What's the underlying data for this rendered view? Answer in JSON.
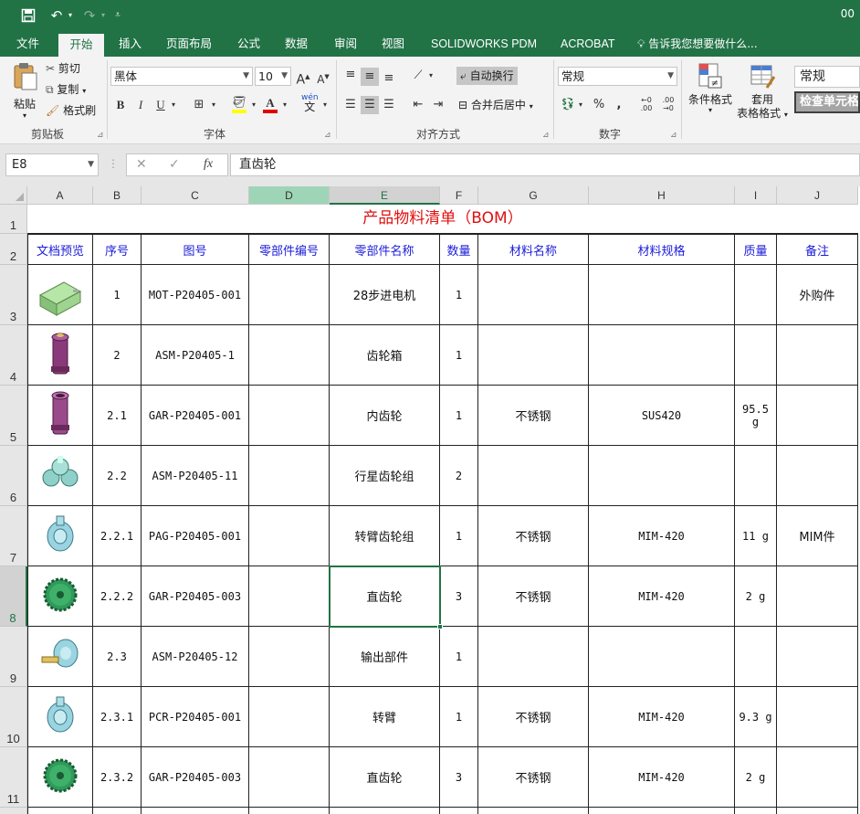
{
  "titlebar": {
    "right_text": "00"
  },
  "tabs": [
    "文件",
    "开始",
    "插入",
    "页面布局",
    "公式",
    "数据",
    "审阅",
    "视图",
    "SOLIDWORKS PDM",
    "ACROBAT"
  ],
  "tell_me": "告诉我您想要做什么...",
  "ribbon": {
    "paste": "粘贴",
    "cut": "剪切",
    "copy": "复制",
    "format_painter": "格式刷",
    "clipboard_group": "剪贴板",
    "font_name": "黑体",
    "font_size": "10",
    "font_group": "字体",
    "wrap_text": "自动换行",
    "merge_center": "合并后居中",
    "align_group": "对齐方式",
    "number_format": "常规",
    "number_group": "数字",
    "conditional_format": "条件格式",
    "table_format_1": "套用",
    "table_format_2": "表格格式",
    "style_normal": "常规",
    "style_check": "检查单元格",
    "bold": "B",
    "italic": "I",
    "underline": "U",
    "grow": "A",
    "shrink": "A",
    "percent": "%",
    "comma": ",",
    "wen": "wén"
  },
  "formula_bar": {
    "name_box": "E8",
    "fx": "fx",
    "content": "直齿轮"
  },
  "grid": {
    "columns": [
      "A",
      "B",
      "C",
      "D",
      "E",
      "F",
      "G",
      "H",
      "I",
      "J"
    ],
    "rows": [
      "1",
      "2",
      "3",
      "4",
      "5",
      "6",
      "7",
      "8",
      "9",
      "10",
      "11"
    ],
    "selected_cell": "E8",
    "title": "产品物料清单（BOM）",
    "headers": [
      "文档预览",
      "序号",
      "图号",
      "零部件编号",
      "零部件名称",
      "数量",
      "材料名称",
      "材料规格",
      "质量",
      "备注"
    ],
    "records": [
      {
        "thumb": "motor",
        "seq": "1",
        "drawing": "MOT-P20405-001",
        "part_no": "",
        "name": "28步进电机",
        "qty": "1",
        "material": "",
        "spec": "",
        "mass": "",
        "note": "外购件"
      },
      {
        "thumb": "gearbox",
        "seq": "2",
        "drawing": "ASM-P20405-1",
        "part_no": "",
        "name": "齿轮箱",
        "qty": "1",
        "material": "",
        "spec": "",
        "mass": "",
        "note": ""
      },
      {
        "thumb": "ring",
        "seq": "2.1",
        "drawing": "GAR-P20405-001",
        "part_no": "",
        "name": "内齿轮",
        "qty": "1",
        "material": "不锈钢",
        "spec": "SUS420",
        "mass": "95.5 g",
        "note": ""
      },
      {
        "thumb": "planet",
        "seq": "2.2",
        "drawing": "ASM-P20405-11",
        "part_no": "",
        "name": "行星齿轮组",
        "qty": "2",
        "material": "",
        "spec": "",
        "mass": "",
        "note": ""
      },
      {
        "thumb": "arm",
        "seq": "2.2.1",
        "drawing": "PAG-P20405-001",
        "part_no": "",
        "name": "转臂齿轮组",
        "qty": "1",
        "material": "不锈钢",
        "spec": "MIM-420",
        "mass": "11 g",
        "note": "MIM件"
      },
      {
        "thumb": "spur",
        "seq": "2.2.2",
        "drawing": "GAR-P20405-003",
        "part_no": "",
        "name": "直齿轮",
        "qty": "3",
        "material": "不锈钢",
        "spec": "MIM-420",
        "mass": "2 g",
        "note": ""
      },
      {
        "thumb": "output",
        "seq": "2.3",
        "drawing": "ASM-P20405-12",
        "part_no": "",
        "name": "输出部件",
        "qty": "1",
        "material": "",
        "spec": "",
        "mass": "",
        "note": ""
      },
      {
        "thumb": "arm",
        "seq": "2.3.1",
        "drawing": "PCR-P20405-001",
        "part_no": "",
        "name": "转臂",
        "qty": "1",
        "material": "不锈钢",
        "spec": "MIM-420",
        "mass": "9.3 g",
        "note": ""
      },
      {
        "thumb": "spur",
        "seq": "2.3.2",
        "drawing": "GAR-P20405-003",
        "part_no": "",
        "name": "直齿轮",
        "qty": "3",
        "material": "不锈钢",
        "spec": "MIM-420",
        "mass": "2 g",
        "note": ""
      }
    ]
  }
}
